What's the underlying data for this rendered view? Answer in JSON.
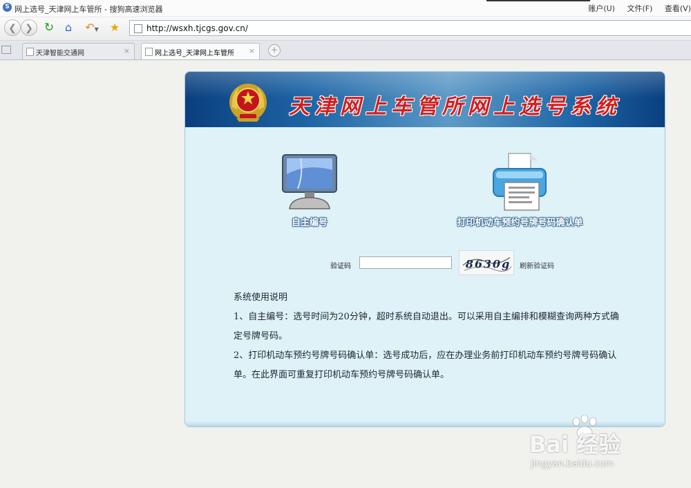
{
  "window": {
    "title": "网上选号_天津网上车管所 - 搜狗高速浏览器",
    "menus": [
      "账户(U)",
      "文件(F)",
      "查看(V)"
    ]
  },
  "toolbar": {
    "address": "http://wsxh.tjcgs.gov.cn/"
  },
  "tabs": [
    {
      "label": "天津智能交通网",
      "active": false
    },
    {
      "label": "网上选号_天津网上车管所",
      "active": true
    }
  ],
  "page": {
    "system_title": "天津网上车管所网上选号系统",
    "features": {
      "self_select": "自主编号",
      "print_confirm": "打印机动车预约号牌号码确认单"
    },
    "captcha": {
      "label": "验证码",
      "value": "",
      "code": "8630g",
      "refresh": "刷新验证码"
    },
    "instructions": {
      "heading": "系统使用说明",
      "item1": "1、自主编号：选号时间为20分钟，超时系统自动退出。可以采用自主编排和模糊查询两种方式确定号牌号码。",
      "item2": "2、打印机动车预约号牌号码确认单：选号成功后，应在办理业务前打印机动车预约号牌号码确认单。在此界面可重复打印机动车预约号牌号码确认单。"
    }
  },
  "watermark": {
    "brand": "Bai 经验",
    "url": "jingyan.baidu.com"
  },
  "colors": {
    "banner": "#1d64a5",
    "title_red": "#d21e1e",
    "panel_bg": "#def2f8"
  }
}
